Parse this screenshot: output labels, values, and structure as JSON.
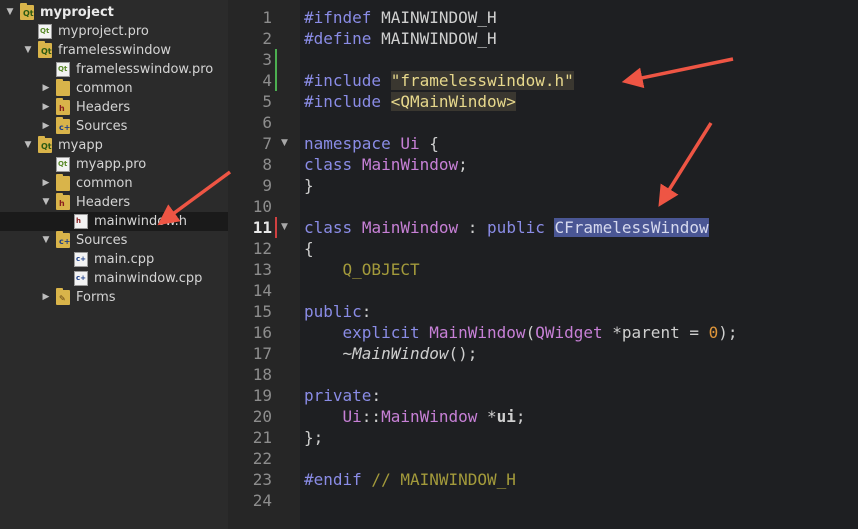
{
  "project_tree": {
    "items": [
      {
        "label": "myproject",
        "icon": "qt-project-folder-icon",
        "expanded": true,
        "bold": true
      },
      {
        "label": "myproject.pro",
        "icon": "pro-file-icon"
      },
      {
        "label": "framelesswindow",
        "icon": "qt-project-folder-icon",
        "expanded": true
      },
      {
        "label": "framelesswindow.pro",
        "icon": "pro-file-icon"
      },
      {
        "label": "common",
        "icon": "folder-icon",
        "expanded": false
      },
      {
        "label": "Headers",
        "icon": "headers-folder-icon",
        "expanded": false
      },
      {
        "label": "Sources",
        "icon": "sources-folder-icon",
        "expanded": false
      },
      {
        "label": "myapp",
        "icon": "qt-project-folder-icon",
        "expanded": true
      },
      {
        "label": "myapp.pro",
        "icon": "pro-file-icon"
      },
      {
        "label": "common",
        "icon": "folder-icon",
        "expanded": false
      },
      {
        "label": "Headers",
        "icon": "headers-folder-icon",
        "expanded": true
      },
      {
        "label": "mainwindow.h",
        "icon": "header-file-icon",
        "selected": true
      },
      {
        "label": "Sources",
        "icon": "sources-folder-icon",
        "expanded": true
      },
      {
        "label": "main.cpp",
        "icon": "cpp-file-icon"
      },
      {
        "label": "mainwindow.cpp",
        "icon": "cpp-file-icon"
      },
      {
        "label": "Forms",
        "icon": "forms-folder-icon",
        "expanded": false
      }
    ]
  },
  "editor": {
    "line_numbers": [
      "1",
      "2",
      "3",
      "4",
      "5",
      "6",
      "7",
      "8",
      "9",
      "10",
      "11",
      "12",
      "13",
      "14",
      "15",
      "16",
      "17",
      "18",
      "19",
      "20",
      "21",
      "22",
      "23",
      "24"
    ],
    "current_line": "11",
    "code": {
      "l1": {
        "kw": "#ifndef",
        "rest": " MAINWINDOW_H"
      },
      "l2": {
        "kw": "#define",
        "rest": " MAINWINDOW_H"
      },
      "l4": {
        "kw": "#include",
        "sp": " ",
        "inc": "\"framelesswindow.h\""
      },
      "l5": {
        "kw": "#include",
        "sp": " ",
        "inc": "<QMainWindow>"
      },
      "l7": {
        "kw": "namespace",
        "sp": " ",
        "name": "Ui",
        "rest": " {"
      },
      "l8": {
        "kw": "class",
        "sp": " ",
        "name": "MainWindow",
        "rest": ";"
      },
      "l9": {
        "text": "}"
      },
      "l11": {
        "kw": "class",
        "sp": " ",
        "name": "MainWindow",
        "colon": " : ",
        "kw2": "public",
        "sp2": " ",
        "base": "CFramelessWindow"
      },
      "l12": {
        "text": "{"
      },
      "l13": {
        "indent": "    ",
        "macro": "Q_OBJECT"
      },
      "l15": {
        "kw": "public",
        "rest": ":"
      },
      "l16": {
        "indent": "    ",
        "kw": "explicit",
        "sp": " ",
        "name": "MainWindow",
        "p1": "(",
        "type": "QWidget",
        "p2": " *parent = ",
        "num": "0",
        "p3": ");"
      },
      "l17": {
        "indent": "    ",
        "tilde": "~",
        "name": "MainWindow",
        "rest": "();"
      },
      "l19": {
        "kw": "private",
        "rest": ":"
      },
      "l20": {
        "indent": "    ",
        "ns": "Ui",
        "sep": "::",
        "name": "MainWindow",
        "p1": " *",
        "var": "ui",
        "p2": ";"
      },
      "l21": {
        "text": "};"
      },
      "l23": {
        "kw": "#endif",
        "comment": " // MAINWINDOW_H"
      }
    }
  },
  "colors": {
    "annotation_arrow": "#ee5544",
    "keyword": "#8a8ce6",
    "class_name": "#c780d6",
    "string": "#e7d88c",
    "highlight": "#4a5694"
  }
}
